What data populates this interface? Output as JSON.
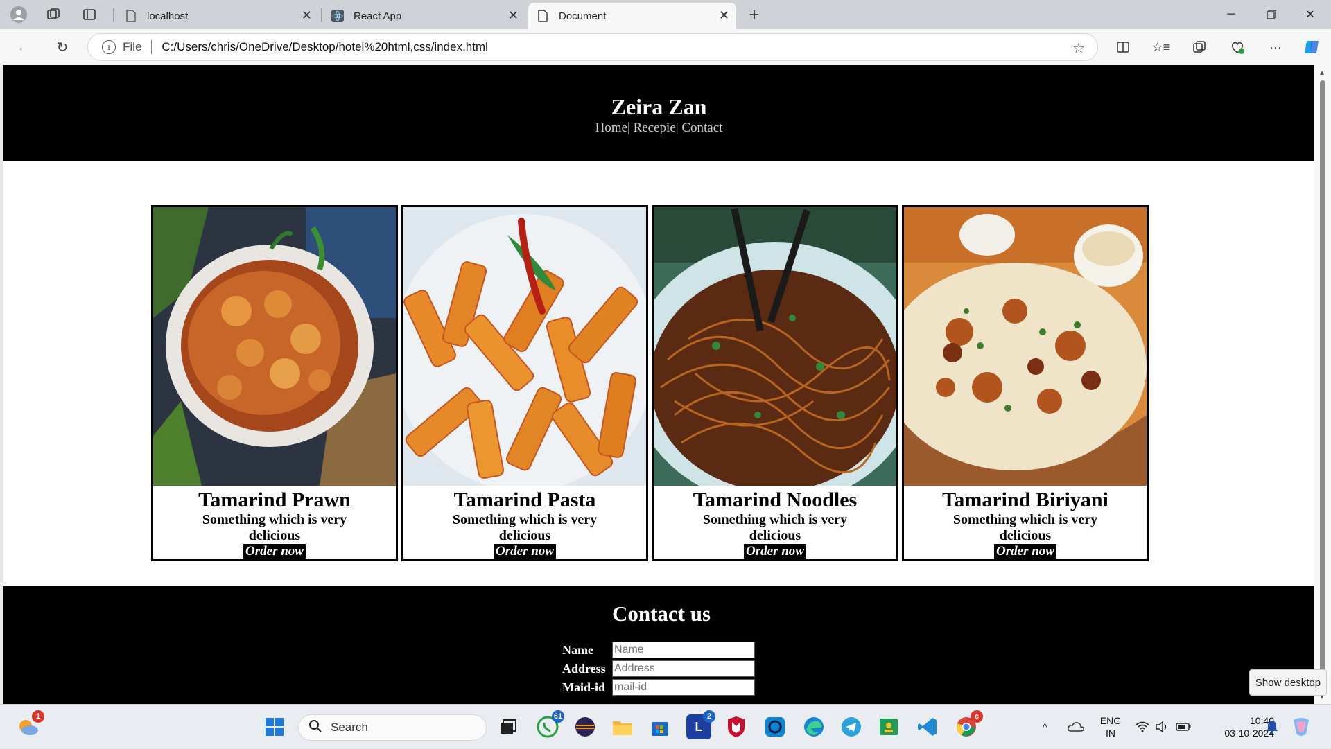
{
  "browser": {
    "tabs": [
      {
        "title": "localhost"
      },
      {
        "title": "React App"
      },
      {
        "title": "Document"
      }
    ],
    "address": {
      "scheme_label": "File",
      "url": "C:/Users/chris/OneDrive/Desktop/hotel%20html,css/index.html"
    }
  },
  "site": {
    "title": "Zeira Zan",
    "nav": [
      "Home|",
      " Recepie|",
      " Contact"
    ],
    "cards": [
      {
        "name": "Tamarind Prawn",
        "desc": "Something which is very delicious",
        "cta": "Order now"
      },
      {
        "name": "Tamarind Pasta",
        "desc": "Something which is very delicious",
        "cta": "Order now"
      },
      {
        "name": "Tamarind Noodles",
        "desc": "Something which is very delicious",
        "cta": "Order now"
      },
      {
        "name": "Tamarind Biriyani",
        "desc": "Something which is very delicious",
        "cta": "Order now"
      }
    ],
    "contact": {
      "title": "Contact us",
      "fields": [
        {
          "label": "Name",
          "placeholder": "Name"
        },
        {
          "label": "Address",
          "placeholder": "Address"
        },
        {
          "label": "Maid-id",
          "placeholder": "mail-id"
        }
      ]
    }
  },
  "tooltip": "Show desktop",
  "taskbar": {
    "search_placeholder": "Search",
    "weather_badge": "1",
    "whatsapp_badge": "61",
    "lens_badge": "2",
    "chrome_badge": "c",
    "lang_line1": "ENG",
    "lang_line2": "IN",
    "time": "10:40",
    "date": "03-10-2024"
  }
}
